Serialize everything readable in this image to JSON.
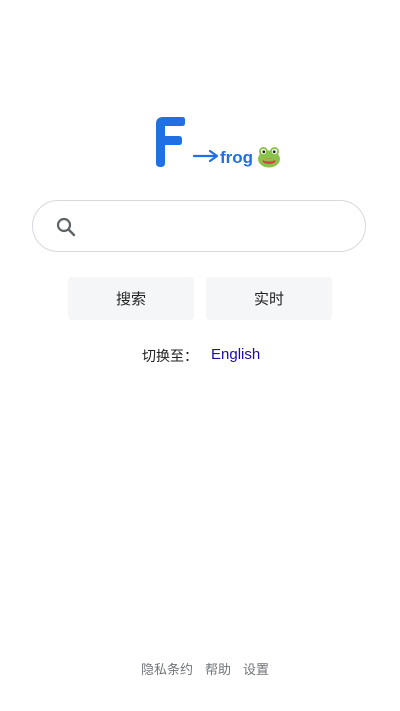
{
  "logo": {
    "letter": "F",
    "arrow": "→",
    "word": "frog",
    "frog_emoji": "frog-icon",
    "brand_color": "#1f6fe5"
  },
  "search": {
    "value": "",
    "placeholder": ""
  },
  "buttons": {
    "search_label": "搜索",
    "live_label": "实时"
  },
  "language": {
    "label": "切换至：",
    "link": "English"
  },
  "footer": {
    "privacy": "隐私条约",
    "help": "帮助",
    "settings": "设置"
  },
  "colors": {
    "link": "#1a0dab",
    "button_bg": "#f5f6f8",
    "footer_text": "#70757a"
  }
}
